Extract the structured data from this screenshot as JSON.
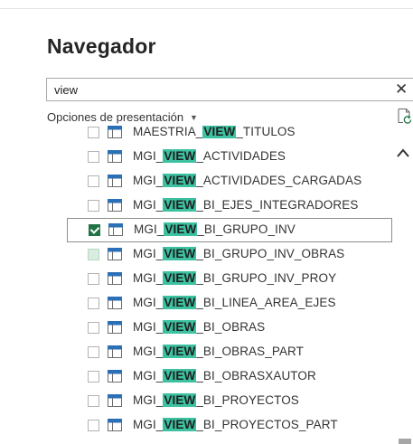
{
  "navigator": {
    "title": "Navegador",
    "search_value": "view",
    "clear_glyph": "✕",
    "options_label": "Opciones de presentación",
    "options_caret": "▼",
    "highlight_color": "#3cc2a1",
    "checked_color": "#217346"
  },
  "items": [
    {
      "prefix": "MAESTRIA_",
      "match": "VIEW",
      "suffix": "_TITULOS",
      "checked": false
    },
    {
      "prefix": "MGI_",
      "match": "VIEW",
      "suffix": "_ACTIVIDADES",
      "checked": false
    },
    {
      "prefix": "MGI_",
      "match": "VIEW",
      "suffix": "_ACTIVIDADES_CARGADAS",
      "checked": false
    },
    {
      "prefix": "MGI_",
      "match": "VIEW",
      "suffix": "_BI_EJES_INTEGRADORES",
      "checked": false
    },
    {
      "prefix": "MGI_",
      "match": "VIEW",
      "suffix": "_BI_GRUPO_INV",
      "checked": true,
      "selected": true
    },
    {
      "prefix": "MGI_",
      "match": "VIEW",
      "suffix": "_BI_GRUPO_INV_OBRAS",
      "checked": false,
      "hover": true
    },
    {
      "prefix": "MGI_",
      "match": "VIEW",
      "suffix": "_BI_GRUPO_INV_PROY",
      "checked": false
    },
    {
      "prefix": "MGI_",
      "match": "VIEW",
      "suffix": "_BI_LINEA_AREA_EJES",
      "checked": false
    },
    {
      "prefix": "MGI_",
      "match": "VIEW",
      "suffix": "_BI_OBRAS",
      "checked": false
    },
    {
      "prefix": "MGI_",
      "match": "VIEW",
      "suffix": "_BI_OBRAS_PART",
      "checked": false
    },
    {
      "prefix": "MGI_",
      "match": "VIEW",
      "suffix": "_BI_OBRASXAUTOR",
      "checked": false
    },
    {
      "prefix": "MGI_",
      "match": "VIEW",
      "suffix": "_BI_PROYECTOS",
      "checked": false
    },
    {
      "prefix": "MGI_",
      "match": "VIEW",
      "suffix": "_BI_PROYECTOS_PART",
      "checked": false
    }
  ]
}
